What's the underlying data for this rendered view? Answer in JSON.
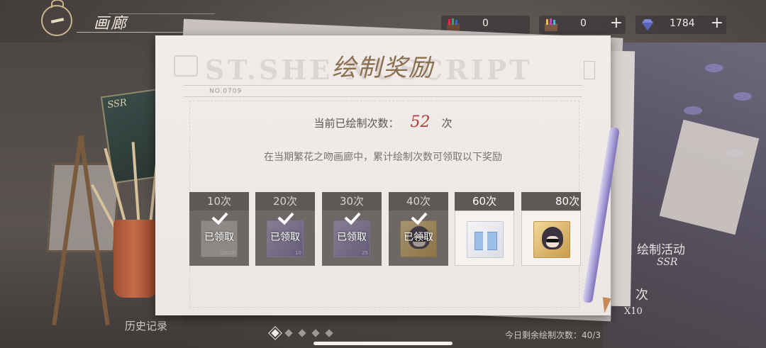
{
  "header": {
    "title": "画廊",
    "help_glyph": "?"
  },
  "resources": [
    {
      "icon": "paint-set-icon",
      "value": "0"
    },
    {
      "icon": "paint-set-alt-icon",
      "value": "0",
      "plus": "+"
    },
    {
      "icon": "diamond-icon",
      "value": "1784",
      "plus": "+"
    }
  ],
  "dialog": {
    "title": "绘制奖励",
    "watermark": "ST.SHE         NUSCRIPT",
    "form_no": "NO.0709",
    "count_prefix": "当前已绘制次数：",
    "count_value": "52",
    "count_suffix": "次",
    "description": "在当期繁花之吻画廊中，累计绘制次数可领取以下奖励"
  },
  "rewards": [
    {
      "label": "10次",
      "status": "已领取",
      "item_sub": "10000",
      "style": "gray"
    },
    {
      "label": "20次",
      "status": "已领取",
      "item_sub": "10",
      "style": "purple"
    },
    {
      "label": "30次",
      "status": "已领取",
      "item_sub": "25",
      "style": "purple"
    },
    {
      "label": "40次",
      "status": "已领取",
      "item_sub": "",
      "style": "gold"
    },
    {
      "label": "60次",
      "status": "",
      "item_sub": "",
      "style": "light"
    },
    {
      "label": "80次",
      "status": "",
      "item_sub": "",
      "style": "gold"
    }
  ],
  "background_text": {
    "card_rarity": "SSR",
    "right_label": "绘制活动",
    "right_badge": "SSR",
    "right_times": "次",
    "right_multiplier": "X10",
    "bottom_right": "今日剩余绘制次数：40/3",
    "bottom_left": "历史记录"
  },
  "pager": {
    "count": 5,
    "active": 0
  }
}
